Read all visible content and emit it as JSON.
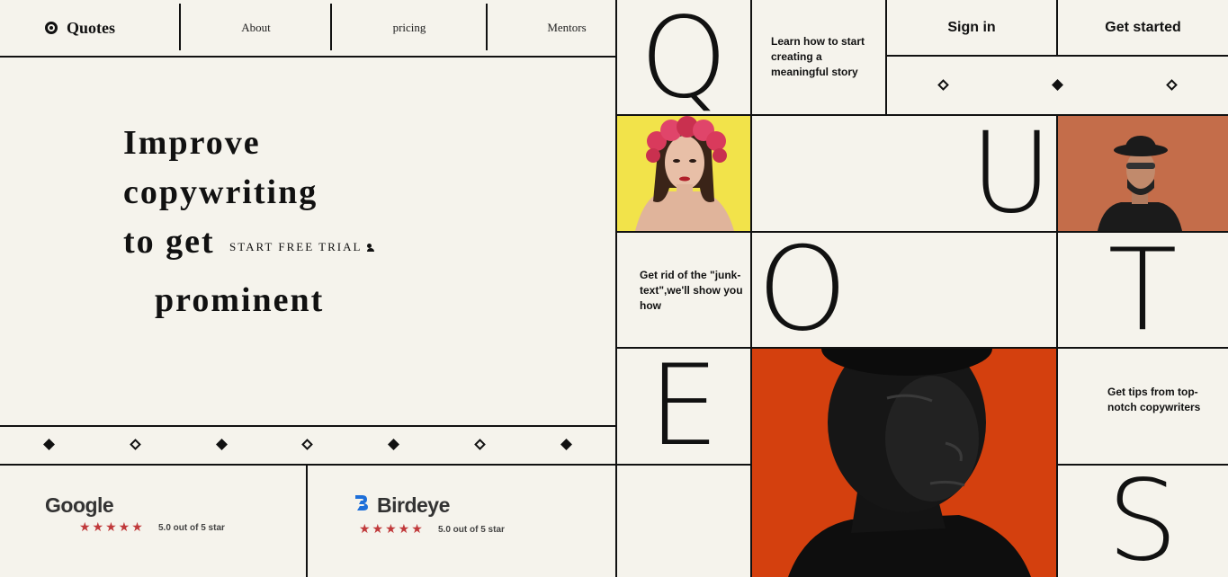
{
  "nav": {
    "logo": "Quotes",
    "about": "About",
    "pricing": "pricing",
    "mentors": "Mentors"
  },
  "hero": {
    "line1": "Improve",
    "line2": "copywriting",
    "line3": "to get",
    "line4": "prominent",
    "trial_label": "START FREE TRIAL"
  },
  "reviews": [
    {
      "brand": "Google",
      "stars": "★★★★★",
      "rating": "5.0 out of 5 star"
    },
    {
      "brand": "Birdeye",
      "stars": "★★★★★",
      "rating": "5.0 out of 5 star"
    }
  ],
  "header_actions": {
    "signin": "Sign in",
    "get_started": "Get started"
  },
  "letters": [
    "Q",
    "U",
    "O",
    "T",
    "E",
    "S"
  ],
  "tiles": {
    "learn": "Learn how to start creating a meaningful story",
    "junk": "Get rid of the \"junk-text\",we'll show you how",
    "tips": "Get tips from top-notch copywriters"
  },
  "colors": {
    "background": "#f5f3ec",
    "line": "#111111",
    "star": "#c0393b",
    "photo_yellow": "#f2e34a",
    "photo_terracotta": "#c9714f",
    "photo_orange": "#d4400e",
    "birdeye_blue": "#1e6fd9"
  }
}
